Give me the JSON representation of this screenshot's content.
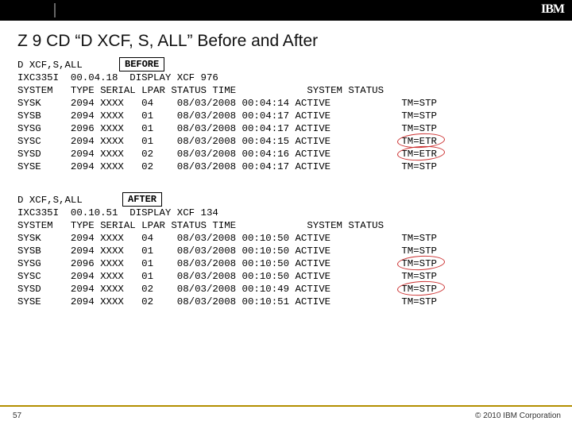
{
  "header": {
    "logo": "IBM"
  },
  "title": "Z 9 CD “D XCF, S, ALL” Before and After",
  "before": {
    "label": "BEFORE",
    "cmd": "D XCF,S,ALL",
    "msg": "IXC335I  00.04.18  DISPLAY XCF 976",
    "cols": "SYSTEM   TYPE SERIAL LPAR STATUS TIME            SYSTEM STATUS",
    "rows": [
      {
        "sys": "SYSK",
        "type": "2094",
        "ser": "XXXX",
        "lpar": "04",
        "date": "08/03/2008",
        "time": "00:04:14",
        "stat": "ACTIVE",
        "tm": "TM=STP",
        "circ": false
      },
      {
        "sys": "SYSB",
        "type": "2094",
        "ser": "XXXX",
        "lpar": "01",
        "date": "08/03/2008",
        "time": "00:04:17",
        "stat": "ACTIVE",
        "tm": "TM=STP",
        "circ": false
      },
      {
        "sys": "SYSG",
        "type": "2096",
        "ser": "XXXX",
        "lpar": "01",
        "date": "08/03/2008",
        "time": "00:04:17",
        "stat": "ACTIVE",
        "tm": "TM=STP",
        "circ": false
      },
      {
        "sys": "SYSC",
        "type": "2094",
        "ser": "XXXX",
        "lpar": "01",
        "date": "08/03/2008",
        "time": "00:04:15",
        "stat": "ACTIVE",
        "tm": "TM=ETR",
        "circ": true
      },
      {
        "sys": "SYSD",
        "type": "2094",
        "ser": "XXXX",
        "lpar": "02",
        "date": "08/03/2008",
        "time": "00:04:16",
        "stat": "ACTIVE",
        "tm": "TM=ETR",
        "circ": true
      },
      {
        "sys": "SYSE",
        "type": "2094",
        "ser": "XXXX",
        "lpar": "02",
        "date": "08/03/2008",
        "time": "00:04:17",
        "stat": "ACTIVE",
        "tm": "TM=STP",
        "circ": false
      }
    ]
  },
  "after": {
    "label": "AFTER",
    "cmd": "D XCF,S,ALL",
    "msg": "IXC335I  00.10.51  DISPLAY XCF 134",
    "cols": "SYSTEM   TYPE SERIAL LPAR STATUS TIME            SYSTEM STATUS",
    "rows": [
      {
        "sys": "SYSK",
        "type": "2094",
        "ser": "XXXX",
        "lpar": "04",
        "date": "08/03/2008",
        "time": "00:10:50",
        "stat": "ACTIVE",
        "tm": "TM=STP",
        "circ": false
      },
      {
        "sys": "SYSB",
        "type": "2094",
        "ser": "XXXX",
        "lpar": "01",
        "date": "08/03/2008",
        "time": "00:10:50",
        "stat": "ACTIVE",
        "tm": "TM=STP",
        "circ": false
      },
      {
        "sys": "SYSG",
        "type": "2096",
        "ser": "XXXX",
        "lpar": "01",
        "date": "08/03/2008",
        "time": "00:10:50",
        "stat": "ACTIVE",
        "tm": "TM=STP",
        "circ": true
      },
      {
        "sys": "SYSC",
        "type": "2094",
        "ser": "XXXX",
        "lpar": "01",
        "date": "08/03/2008",
        "time": "00:10:50",
        "stat": "ACTIVE",
        "tm": "TM=STP",
        "circ": false
      },
      {
        "sys": "SYSD",
        "type": "2094",
        "ser": "XXXX",
        "lpar": "02",
        "date": "08/03/2008",
        "time": "00:10:49",
        "stat": "ACTIVE",
        "tm": "TM=STP",
        "circ": true
      },
      {
        "sys": "SYSE",
        "type": "2094",
        "ser": "XXXX",
        "lpar": "02",
        "date": "08/03/2008",
        "time": "00:10:51",
        "stat": "ACTIVE",
        "tm": "TM=STP",
        "circ": false
      }
    ]
  },
  "footer": {
    "page": "57",
    "copyright": "© 2010 IBM Corporation"
  }
}
